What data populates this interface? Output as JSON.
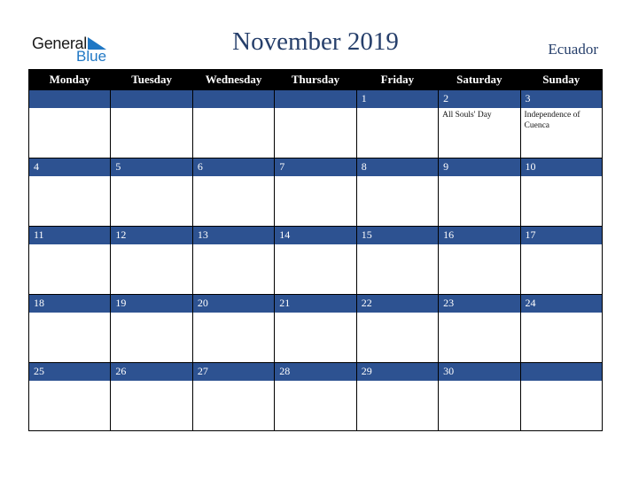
{
  "logo": {
    "word1": "General",
    "word2": "Blue",
    "accent_color": "#1f77c4"
  },
  "title": "November 2019",
  "country": "Ecuador",
  "colors": {
    "header_bg": "#000000",
    "date_bar": "#2d5291",
    "title_text": "#263f6b"
  },
  "weekdays": [
    "Monday",
    "Tuesday",
    "Wednesday",
    "Thursday",
    "Friday",
    "Saturday",
    "Sunday"
  ],
  "weeks": [
    [
      {
        "day": "",
        "event": ""
      },
      {
        "day": "",
        "event": ""
      },
      {
        "day": "",
        "event": ""
      },
      {
        "day": "",
        "event": ""
      },
      {
        "day": "1",
        "event": ""
      },
      {
        "day": "2",
        "event": "All Souls' Day"
      },
      {
        "day": "3",
        "event": "Independence of Cuenca"
      }
    ],
    [
      {
        "day": "4",
        "event": ""
      },
      {
        "day": "5",
        "event": ""
      },
      {
        "day": "6",
        "event": ""
      },
      {
        "day": "7",
        "event": ""
      },
      {
        "day": "8",
        "event": ""
      },
      {
        "day": "9",
        "event": ""
      },
      {
        "day": "10",
        "event": ""
      }
    ],
    [
      {
        "day": "11",
        "event": ""
      },
      {
        "day": "12",
        "event": ""
      },
      {
        "day": "13",
        "event": ""
      },
      {
        "day": "14",
        "event": ""
      },
      {
        "day": "15",
        "event": ""
      },
      {
        "day": "16",
        "event": ""
      },
      {
        "day": "17",
        "event": ""
      }
    ],
    [
      {
        "day": "18",
        "event": ""
      },
      {
        "day": "19",
        "event": ""
      },
      {
        "day": "20",
        "event": ""
      },
      {
        "day": "21",
        "event": ""
      },
      {
        "day": "22",
        "event": ""
      },
      {
        "day": "23",
        "event": ""
      },
      {
        "day": "24",
        "event": ""
      }
    ],
    [
      {
        "day": "25",
        "event": ""
      },
      {
        "day": "26",
        "event": ""
      },
      {
        "day": "27",
        "event": ""
      },
      {
        "day": "28",
        "event": ""
      },
      {
        "day": "29",
        "event": ""
      },
      {
        "day": "30",
        "event": ""
      },
      {
        "day": "",
        "event": ""
      }
    ]
  ]
}
